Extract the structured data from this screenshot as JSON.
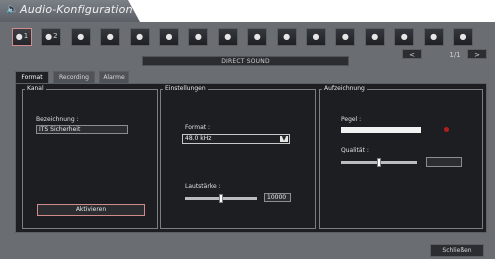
{
  "window": {
    "title": "Audio-Konfiguration",
    "title_icon": "speaker-icon",
    "accent_selected": "#d38a8a",
    "background": "#6a6d72"
  },
  "devices": {
    "buttons": [
      {
        "icon": "speaker-icon",
        "label": "1",
        "selected": true
      },
      {
        "icon": "speaker-icon",
        "label": "2",
        "selected": false
      },
      {
        "icon": "speaker-icon",
        "label": "",
        "selected": false
      },
      {
        "icon": "speaker-icon",
        "label": "",
        "selected": false
      },
      {
        "icon": "speaker-icon",
        "label": "",
        "selected": false
      },
      {
        "icon": "speaker-icon",
        "label": "",
        "selected": false
      },
      {
        "icon": "speaker-icon",
        "label": "",
        "selected": false
      },
      {
        "icon": "speaker-icon",
        "label": "",
        "selected": false
      },
      {
        "icon": "speaker-icon",
        "label": "",
        "selected": false
      },
      {
        "icon": "speaker-icon",
        "label": "",
        "selected": false
      },
      {
        "icon": "speaker-icon",
        "label": "",
        "selected": false
      },
      {
        "icon": "speaker-icon",
        "label": "",
        "selected": false
      },
      {
        "icon": "speaker-icon",
        "label": "",
        "selected": false
      },
      {
        "icon": "speaker-icon",
        "label": "",
        "selected": false
      },
      {
        "icon": "speaker-icon",
        "label": "",
        "selected": false
      },
      {
        "icon": "speaker-icon",
        "label": "",
        "selected": false
      }
    ],
    "pager": {
      "prev": "<",
      "page": "1/1",
      "next": ">"
    },
    "sound_system": "DIRECT SOUND"
  },
  "tabs": [
    "Format",
    "Recording",
    "Alarme"
  ],
  "kanal": {
    "title": "Kanal",
    "name_label": "Bezeichnung :",
    "name_value": "ITS Sicherheit",
    "activate_button": "Aktivieren"
  },
  "einstellungen": {
    "title": "Einstellungen",
    "format_label": "Format :",
    "format_value": "48.0 kHz",
    "volume_label": "Lautstärke :",
    "volume_value": "10000",
    "volume_level": 0.5
  },
  "aufzeichnung": {
    "title": "Aufzeichnung",
    "level_label": "Pegel :",
    "quality_label": "Qualität :",
    "quality_level": 0.5,
    "quality_value": ""
  },
  "footer": {
    "close_button": "Schließen"
  }
}
